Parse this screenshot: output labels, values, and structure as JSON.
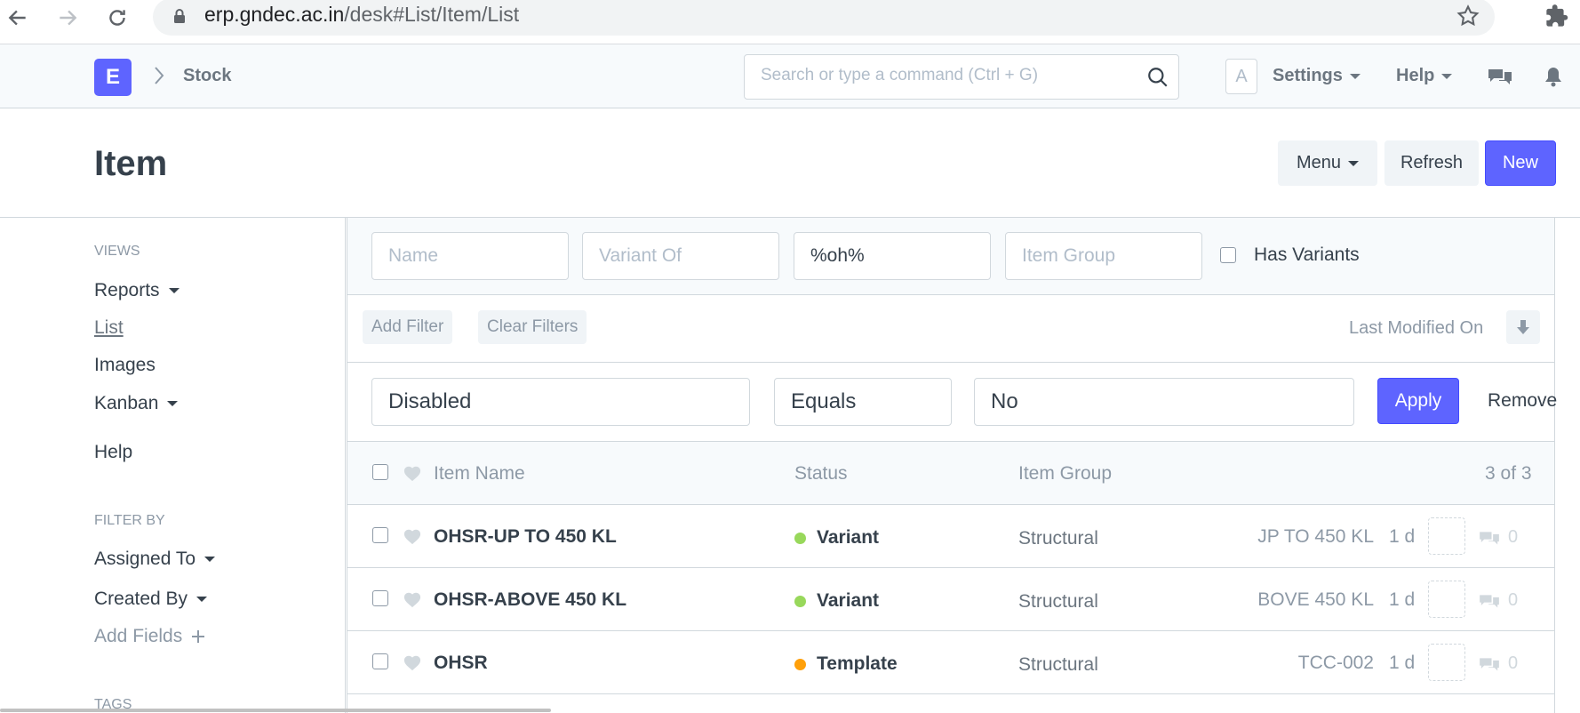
{
  "browser": {
    "url_domain": "erp.gndec.ac.in",
    "url_path": "/desk#List/Item/List"
  },
  "navbar": {
    "logo_letter": "E",
    "breadcrumb": "Stock",
    "search_placeholder": "Search or type a command (Ctrl + G)",
    "avatar_letter": "A",
    "settings_label": "Settings",
    "help_label": "Help"
  },
  "page": {
    "title": "Item",
    "menu_label": "Menu",
    "refresh_label": "Refresh",
    "new_label": "New"
  },
  "sidebar": {
    "views_heading": "VIEWS",
    "reports": "Reports",
    "list": "List",
    "images": "Images",
    "kanban": "Kanban",
    "help": "Help",
    "filter_by_heading": "FILTER BY",
    "assigned_to": "Assigned To",
    "created_by": "Created By",
    "add_fields": "Add Fields",
    "tags_heading": "TAGS"
  },
  "filters": {
    "name_placeholder": "Name",
    "variant_of_placeholder": "Variant Of",
    "item_name_value": "%oh%",
    "item_group_placeholder": "Item Group",
    "has_variants_label": "Has Variants",
    "add_filter": "Add Filter",
    "clear_filters": "Clear Filters",
    "sort_label": "Last Modified On",
    "condition": {
      "field": "Disabled",
      "operator": "Equals",
      "value": "No",
      "apply": "Apply",
      "remove": "Remove"
    }
  },
  "list": {
    "columns": {
      "item_name": "Item Name",
      "status": "Status",
      "item_group": "Item Group",
      "count": "3 of 3"
    },
    "status_colors": {
      "Variant": "#98d85b",
      "Template": "#ffa00a"
    },
    "rows": [
      {
        "name": "OHSR-UP TO 450 KL",
        "status": "Variant",
        "status_color": "#98d85b",
        "group": "Structural",
        "id": "JP TO 450 KL",
        "modified": "1 d",
        "comments": "0"
      },
      {
        "name": "OHSR-ABOVE 450 KL",
        "status": "Variant",
        "status_color": "#98d85b",
        "group": "Structural",
        "id": "BOVE 450 KL",
        "modified": "1 d",
        "comments": "0"
      },
      {
        "name": "OHSR",
        "status": "Template",
        "status_color": "#ffa00a",
        "group": "Structural",
        "id": "TCC-002",
        "modified": "1 d",
        "comments": "0"
      }
    ]
  }
}
